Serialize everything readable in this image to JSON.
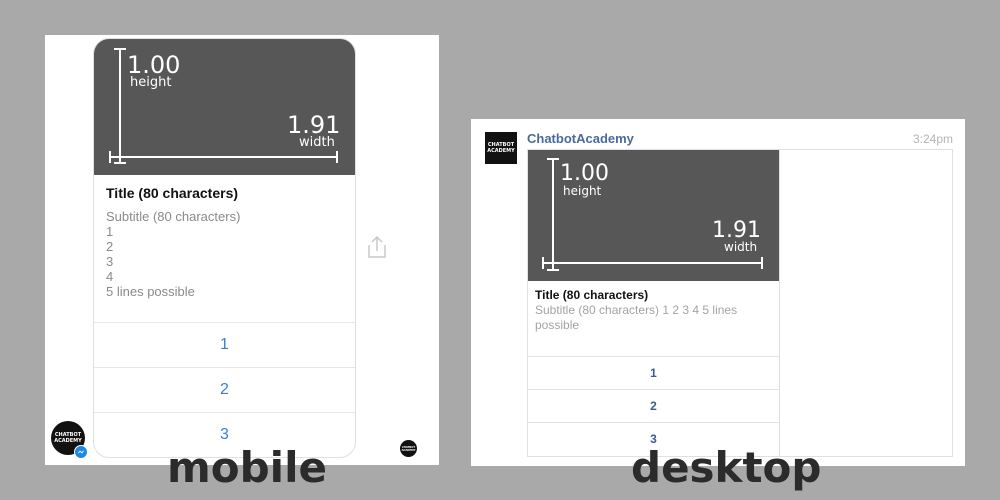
{
  "ruler": {
    "height_value": "1.00",
    "height_label": "height",
    "width_value": "1.91",
    "width_label": "width"
  },
  "mobile": {
    "caption": "mobile",
    "title": "Title (80 characters)",
    "subtitle_lines": [
      "Subtitle (80 characters)",
      "1",
      "2",
      "3",
      "4",
      "5 lines possible"
    ],
    "buttons": [
      "1",
      "2",
      "3"
    ],
    "avatar_text": [
      "CHATBOT",
      "ACADEMY"
    ],
    "small_avatar_text": [
      "CHATBOT",
      "ACADEMY"
    ]
  },
  "desktop": {
    "caption": "desktop",
    "sender": "ChatbotAcademy",
    "time": "3:24pm",
    "avatar_text": [
      "CHATBOT",
      "ACADEMY"
    ],
    "title": "Title (80 characters)",
    "subtitle": "Subtitle (80 characters) 1 2 3 4 5 lines possible",
    "buttons": [
      "1",
      "2",
      "3"
    ]
  },
  "colors": {
    "background": "#a9a9a9",
    "image_gray": "#575757",
    "mobile_link": "#3a7fd0",
    "desktop_link": "#3d5b8e",
    "sender": "#4a6a9c"
  }
}
